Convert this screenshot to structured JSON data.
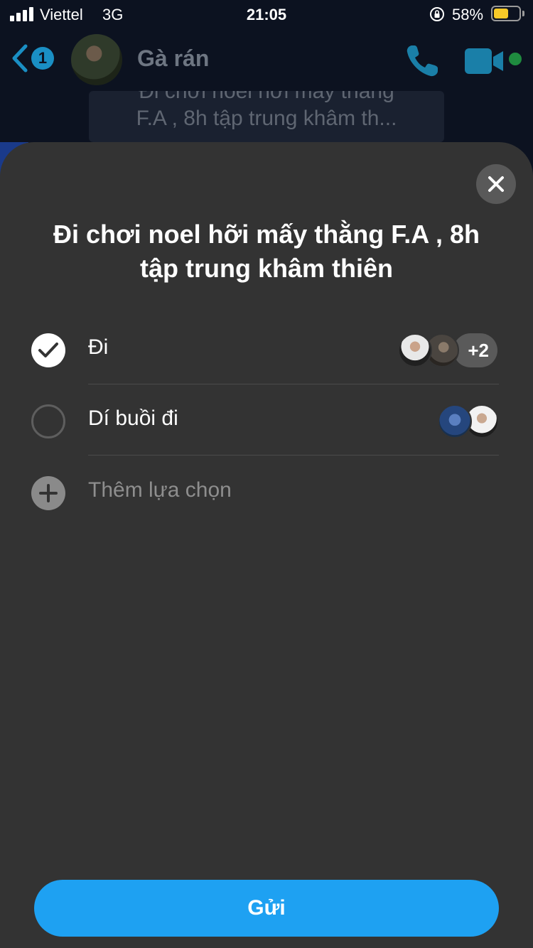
{
  "status_bar": {
    "carrier": "Viettel",
    "network": "3G",
    "time": "21:05",
    "battery_percent": "58%",
    "battery_level": 0.58,
    "battery_color": "#f7c928"
  },
  "chat_header": {
    "unread_count": "1",
    "contact_name": "Gà rán",
    "pinned_message_line1": "Đi chơi noel hơi mấy thằng",
    "pinned_message_line2": "F.A , 8h tập trung khâm th...",
    "accent_color": "#1a8fc4",
    "icons": [
      "back-icon",
      "phone-icon",
      "video-camera-icon"
    ]
  },
  "poll": {
    "title": "Đi chơi noel hỡi mấy thằng F.A , 8h tập trung khâm thiên",
    "options": [
      {
        "label": "Đi",
        "selected": true,
        "voter_avatars": 2,
        "more_count": "+2"
      },
      {
        "label": "Dí buồi đi",
        "selected": false,
        "voter_avatars": 2,
        "more_count": ""
      }
    ],
    "add_option_placeholder": "Thêm lựa chọn",
    "send_label": "Gửi",
    "send_color": "#1ea1f2",
    "icons": [
      "close-icon",
      "check-icon",
      "plus-icon"
    ]
  }
}
